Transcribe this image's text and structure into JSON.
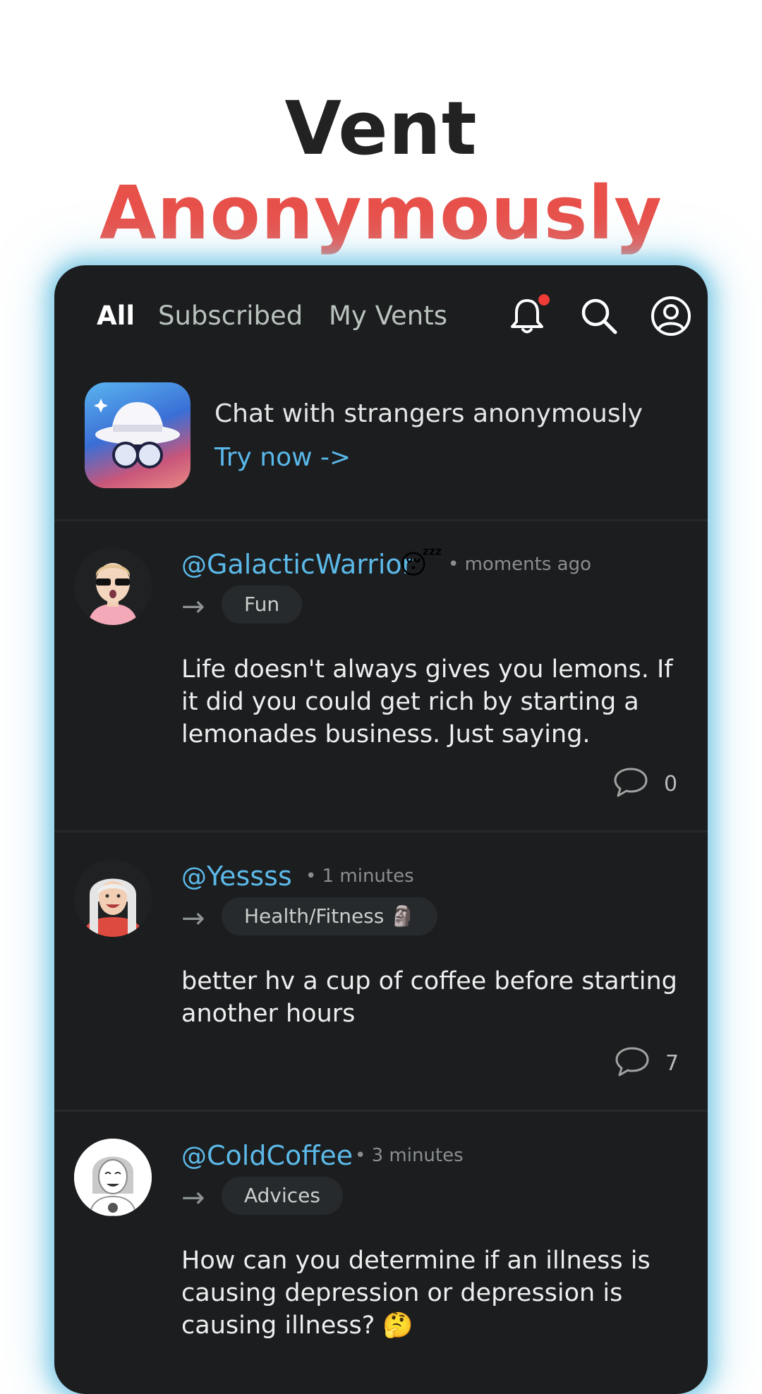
{
  "headline": {
    "word1": "Vent",
    "word2": "Anonymously"
  },
  "colors": {
    "accent_red": "#e8504a",
    "link_blue": "#5cb9e8",
    "background": "#1b1d1f"
  },
  "tabs": {
    "all": "All",
    "subscribed": "Subscribed",
    "my_vents": "My Vents"
  },
  "icons": {
    "notifications": "bell-icon",
    "search": "search-icon",
    "account": "account-circle-icon",
    "comments": "comment-bubble-icon",
    "arrow": "right-arrow"
  },
  "promo": {
    "title": "Chat with strangers anonymously",
    "link": "Try now ->"
  },
  "posts": [
    {
      "at": "@",
      "username": "GalacticWarrior",
      "mood": "😴",
      "time": "• moments ago",
      "arrow": "→",
      "category": "Fun",
      "body": "Life doesn't always gives you lemons. If it did you could get rich by starting a lemonades business. Just saying.",
      "comments": "0"
    },
    {
      "at": "@",
      "username": "Yessss",
      "time": "• 1 minutes",
      "arrow": "→",
      "category": "Health/Fitness 🗿",
      "body": "better hv a cup of coffee before starting another hours",
      "comments": "7"
    },
    {
      "at": "@",
      "username": "ColdCoffee",
      "time": "• 3 minutes",
      "arrow": "→",
      "category": "Advices",
      "body": "How can you determine if an illness is causing depression or depression is causing illness? 🤔"
    }
  ]
}
